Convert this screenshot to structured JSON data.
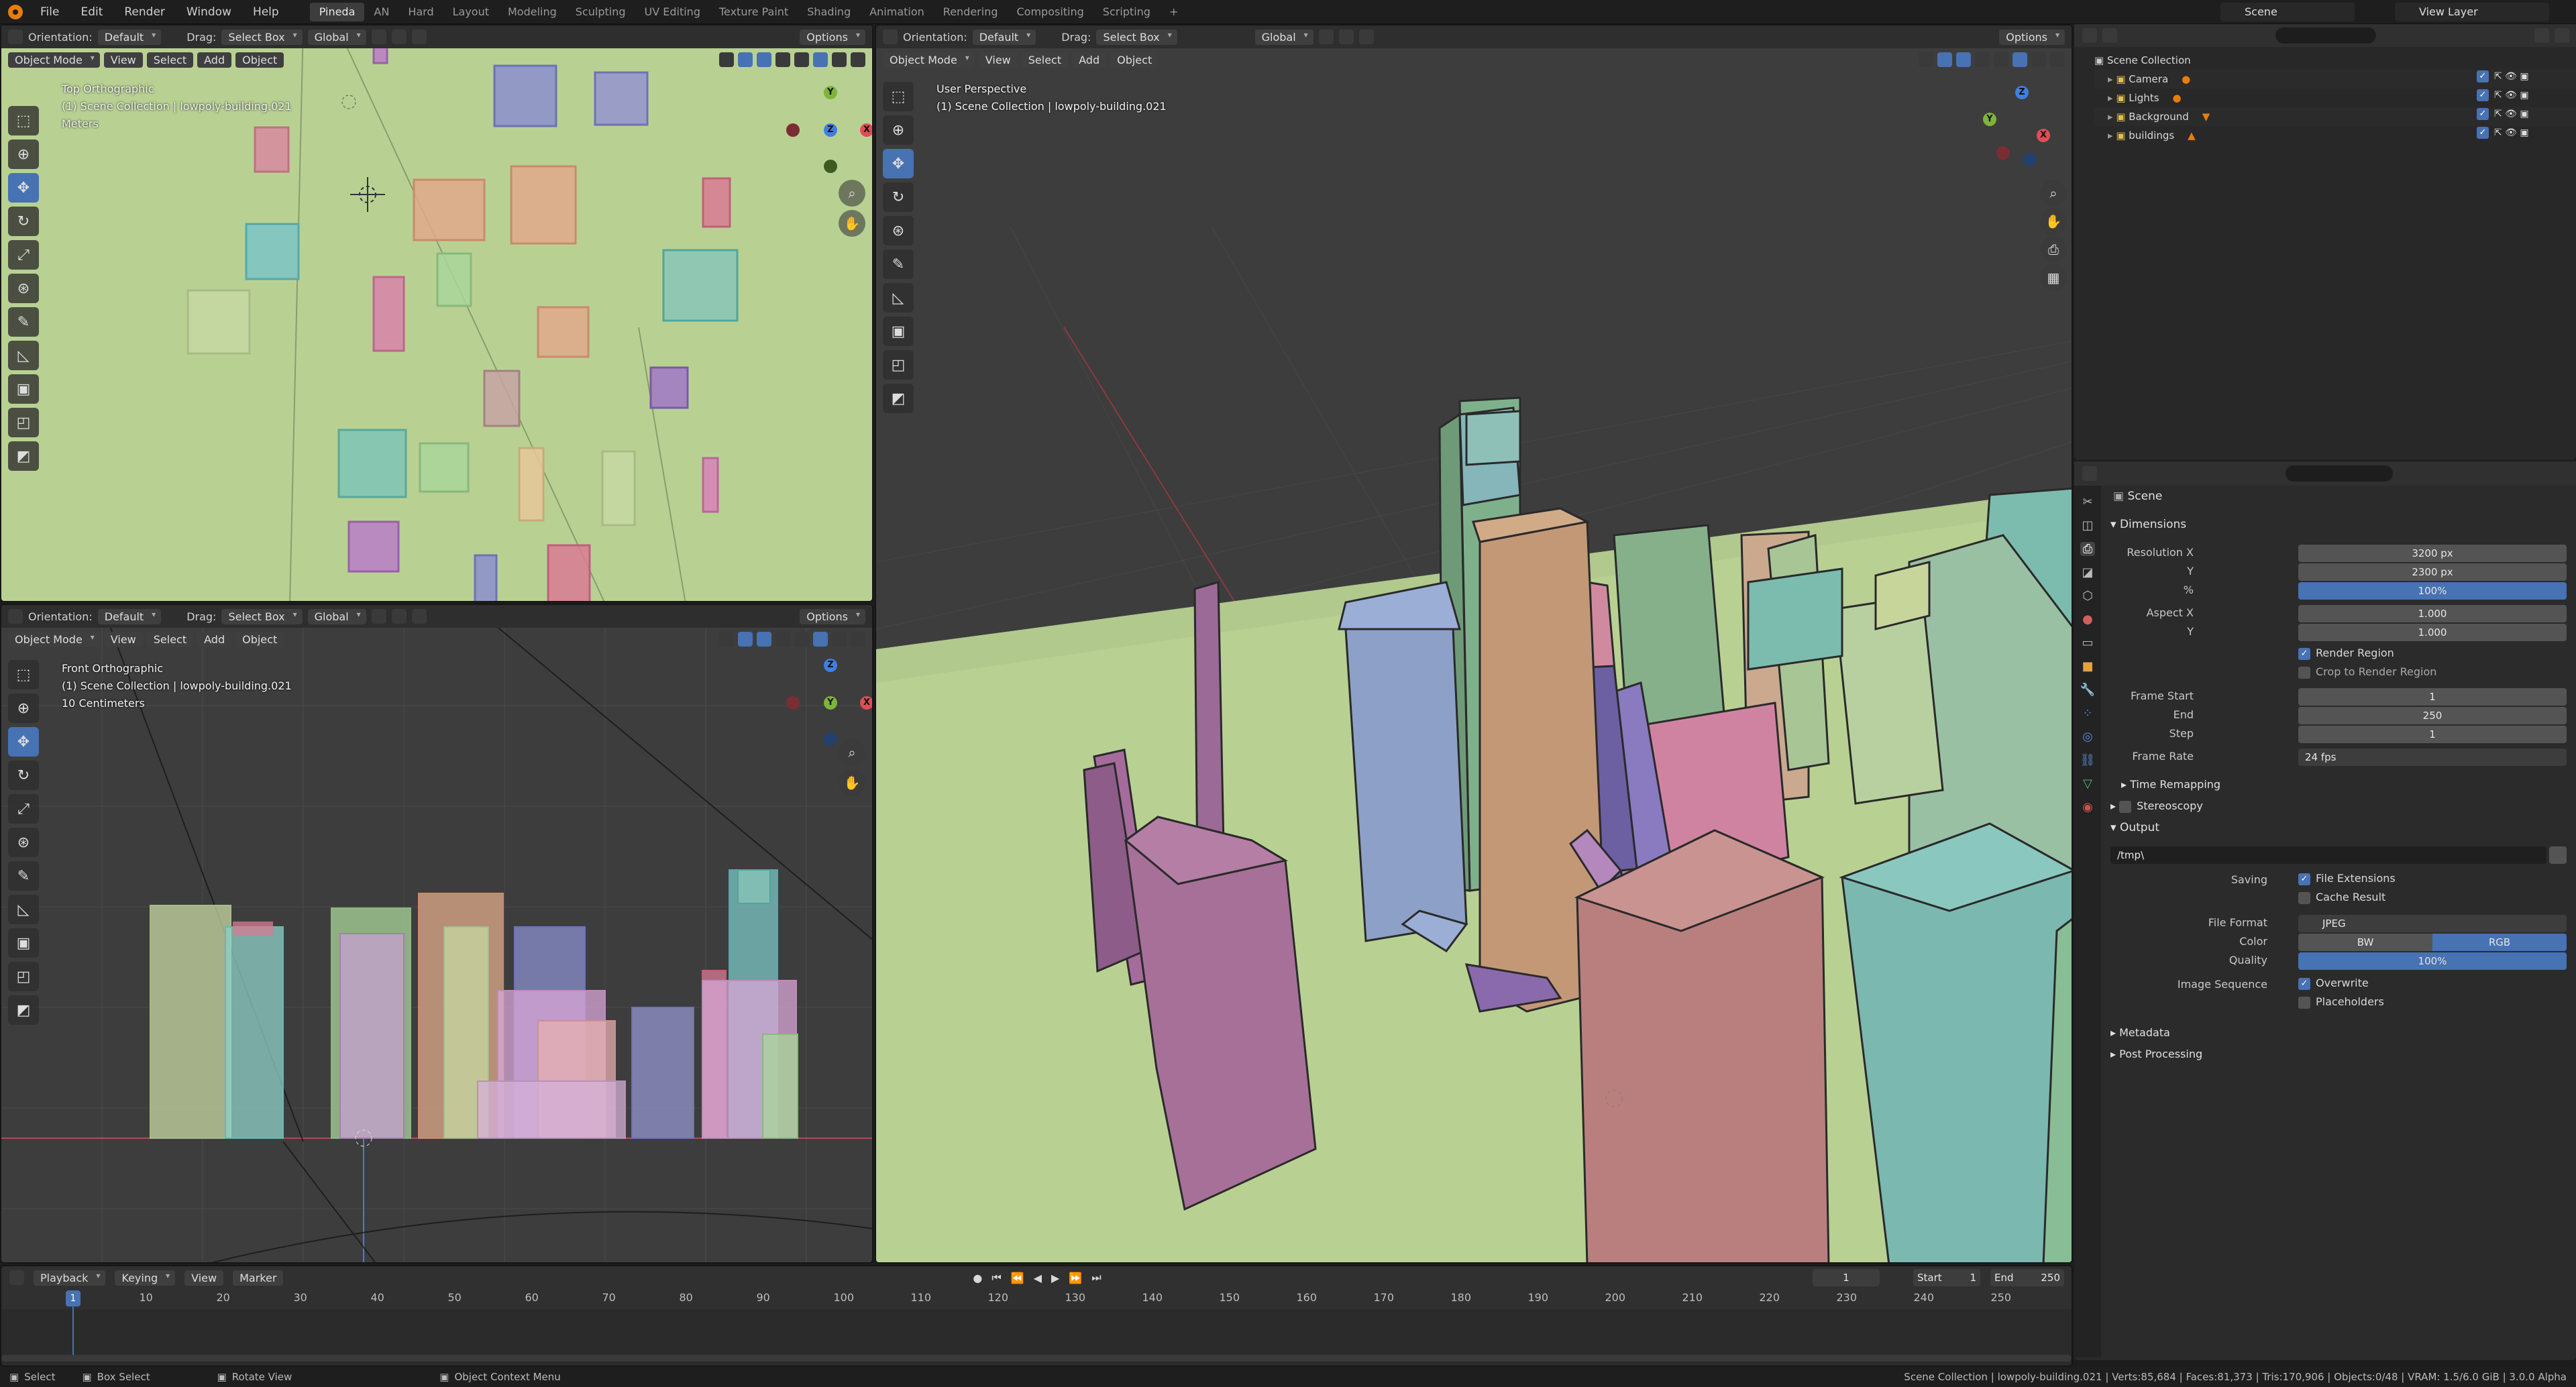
{
  "menu": [
    "File",
    "Edit",
    "Render",
    "Window",
    "Help"
  ],
  "workspaces": [
    "Pineda",
    "AN",
    "Hard",
    "Layout",
    "Modeling",
    "Sculpting",
    "UV Editing",
    "Texture Paint",
    "Shading",
    "Animation",
    "Rendering",
    "Compositing",
    "Scripting"
  ],
  "active_workspace": "Pineda",
  "scene_name": "Scene",
  "view_layer": "View Layer",
  "viewport_header": {
    "orientation_label": "Orientation:",
    "orientation_value": "Default",
    "drag_label": "Drag:",
    "drag_value": "Select Box",
    "transform_value": "Global",
    "options": "Options",
    "mode": "Object Mode",
    "view": "View",
    "select": "Select",
    "add": "Add",
    "object": "Object"
  },
  "viewport_top": {
    "line1": "Top Orthographic",
    "line2": "(1) Scene Collection | lowpoly-building.021",
    "line3": "Meters"
  },
  "viewport_front": {
    "line1": "Front Orthographic",
    "line2": "(1) Scene Collection | lowpoly-building.021",
    "line3": "10 Centimeters"
  },
  "viewport_persp": {
    "line1": "User Perspective",
    "line2": "(1) Scene Collection | lowpoly-building.021"
  },
  "outliner": {
    "root": "Scene Collection",
    "items": [
      "Camera",
      "Lights",
      "Background",
      "buildings"
    ]
  },
  "properties": {
    "scene_label": "Scene",
    "dimensions": "Dimensions",
    "res_x_label": "Resolution X",
    "res_x": "3200 px",
    "res_y_label": "Y",
    "res_y": "2300 px",
    "pct_label": "%",
    "pct": "100%",
    "aspect_x_label": "Aspect X",
    "aspect_x": "1.000",
    "aspect_y_label": "Y",
    "aspect_y": "1.000",
    "render_region": "Render Region",
    "crop_region": "Crop to Render Region",
    "frame_start_label": "Frame Start",
    "frame_start": "1",
    "end_label": "End",
    "end": "250",
    "step_label": "Step",
    "step": "1",
    "frame_rate_label": "Frame Rate",
    "frame_rate": "24 fps",
    "time_remapping": "Time Remapping",
    "stereoscopy": "Stereoscopy",
    "output": "Output",
    "output_path": "/tmp\\",
    "saving_label": "Saving",
    "file_extensions": "File Extensions",
    "cache_result": "Cache Result",
    "file_format_label": "File Format",
    "file_format": "JPEG",
    "color_label": "Color",
    "color_bw": "BW",
    "color_rgb": "RGB",
    "quality_label": "Quality",
    "quality": "100%",
    "image_sequence_label": "Image Sequence",
    "overwrite": "Overwrite",
    "placeholders": "Placeholders",
    "metadata": "Metadata",
    "post_processing": "Post Processing"
  },
  "timeline": {
    "playback": "Playback",
    "keying": "Keying",
    "view": "View",
    "marker": "Marker",
    "current_frame": "1",
    "start_label": "Start",
    "start": "1",
    "end_label": "End",
    "end": "250",
    "ticks": [
      "1",
      "10",
      "20",
      "30",
      "40",
      "50",
      "60",
      "70",
      "80",
      "90",
      "100",
      "110",
      "120",
      "130",
      "140",
      "150",
      "160",
      "170",
      "180",
      "190",
      "200",
      "210",
      "220",
      "230",
      "240",
      "250"
    ]
  },
  "statusbar": {
    "select": "Select",
    "box_select": "Box Select",
    "rotate_view": "Rotate View",
    "context_menu": "Object Context Menu",
    "stats": "Scene Collection | lowpoly-building.021 | Verts:85,684 | Faces:81,373 | Tris:170,906 | Objects:0/48 | VRAM: 1.5/6.0 GiB | 3.0.0 Alpha"
  },
  "colors": {
    "accent": "#4772b3",
    "ground": "#b8d193",
    "grid_bg": "#3d3d3d",
    "red_axis": "#e04d56",
    "green_axis": "#7eb43a",
    "blue_axis": "#3f7fe0"
  }
}
